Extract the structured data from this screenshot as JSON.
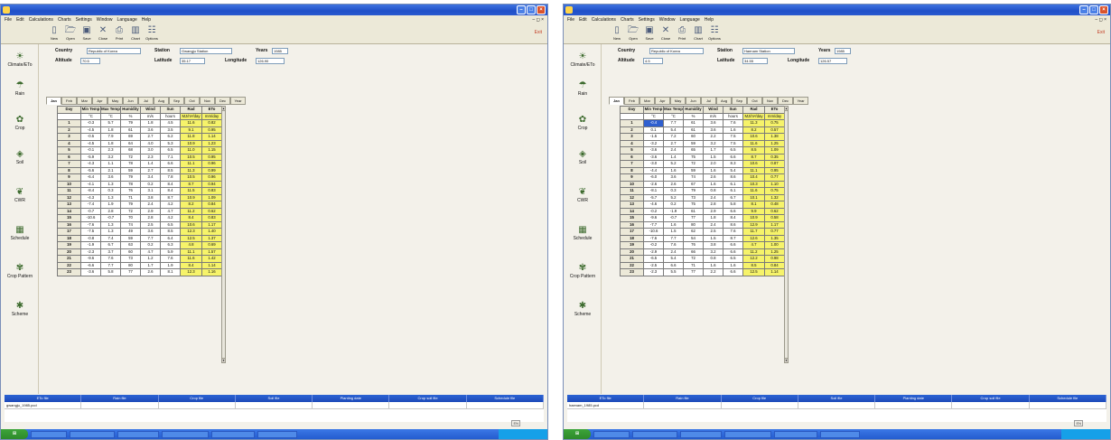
{
  "colors": {
    "title_bar": "#1f4fc7",
    "rad_column": "#f6f36a",
    "selection": "#2f5fd0",
    "taskbar": "#245ccf"
  },
  "menu": [
    "File",
    "Edit",
    "Calculations",
    "Charts",
    "Settings",
    "Window",
    "Language",
    "Help"
  ],
  "toolbar": [
    {
      "icon": "new-icon",
      "label": "New"
    },
    {
      "icon": "open-icon",
      "label": "Open"
    },
    {
      "icon": "save-icon",
      "label": "Save"
    },
    {
      "icon": "close-icon",
      "label": "Close"
    },
    {
      "icon": "print-icon",
      "label": "Print"
    },
    {
      "icon": "chart-icon",
      "label": "Chart"
    },
    {
      "icon": "options-icon",
      "label": "Options"
    }
  ],
  "exit_label": "Exit",
  "sidebar": [
    {
      "icon": "climate-icon",
      "label": "Climate/ETo"
    },
    {
      "icon": "rain-icon",
      "label": "Rain"
    },
    {
      "icon": "crop-icon",
      "label": "Crop"
    },
    {
      "icon": "soil-icon",
      "label": "Soil"
    },
    {
      "icon": "cwr-icon",
      "label": "CWR"
    },
    {
      "icon": "schedule-icon",
      "label": "Schedule"
    },
    {
      "icon": "crop-pattern-icon",
      "label": "Crop Pattern"
    },
    {
      "icon": "scheme-icon",
      "label": "Scheme"
    }
  ],
  "form_labels": {
    "country": "Country",
    "station": "Station",
    "years": "Years",
    "altitude": "Altitude",
    "latitude": "Latitude",
    "longitude": "Longitude"
  },
  "months": [
    "Jan",
    "Feb",
    "Mar",
    "Apr",
    "May",
    "Jun",
    "Jul",
    "Aug",
    "Sep",
    "Oct",
    "Nov",
    "Dec",
    "Year"
  ],
  "grid_headers": [
    "Day",
    "Min Temp",
    "Max Temp",
    "Humidity",
    "Wind",
    "Sun",
    "Rad",
    "ETo"
  ],
  "grid_units": [
    "",
    "°C",
    "°C",
    "%",
    "m/s",
    "hours",
    "MJ/m²/day",
    "mm/day"
  ],
  "file_headers": [
    "ETo file",
    "Rain file",
    "Crop file",
    "Soil file",
    "Planting date",
    "Crop soil file",
    "Schedule file"
  ],
  "shots": [
    {
      "country": "Republic of Korea",
      "station": "Gwangju Station",
      "years": "1985",
      "altitude": "70.5",
      "latitude": "35.17",
      "longitude": "126.90",
      "eto_file": "gwangju_1985.pcd",
      "rows": [
        [
          "1",
          "-0.3",
          "5.7",
          "79",
          "1.8",
          "4.5",
          "11.6",
          "0.82"
        ],
        [
          "2",
          "-4.5",
          "1.8",
          "61",
          "3.6",
          "3.5",
          "9.1",
          "0.95"
        ],
        [
          "3",
          "-0.5",
          "7.9",
          "69",
          "2.7",
          "6.2",
          "11.8",
          "1.14"
        ],
        [
          "4",
          "-4.5",
          "1.8",
          "64",
          "4.0",
          "5.3",
          "10.9",
          "1.23"
        ],
        [
          "5",
          "-0.1",
          "2.3",
          "68",
          "3.0",
          "6.5",
          "11.0",
          "1.15"
        ],
        [
          "6",
          "-5.9",
          "3.2",
          "72",
          "2.3",
          "7.1",
          "10.5",
          "0.95"
        ],
        [
          "7",
          "-4.3",
          "1.1",
          "78",
          "1.4",
          "6.6",
          "11.1",
          "0.96"
        ],
        [
          "8",
          "-5.6",
          "2.1",
          "59",
          "2.7",
          "8.5",
          "11.3",
          "0.99"
        ],
        [
          "9",
          "-6.4",
          "3.6",
          "79",
          "3.4",
          "7.8",
          "10.5",
          "0.96"
        ],
        [
          "10",
          "-4.1",
          "1.3",
          "78",
          "0.2",
          "8.4",
          "8.7",
          "0.94"
        ],
        [
          "11",
          "-8.4",
          "0.3",
          "76",
          "3.1",
          "8.4",
          "11.5",
          "0.83"
        ],
        [
          "12",
          "-4.3",
          "1.3",
          "71",
          "3.8",
          "8.7",
          "10.9",
          "1.09"
        ],
        [
          "13",
          "-7.4",
          "1.9",
          "79",
          "2.4",
          "4.2",
          "8.2",
          "0.84"
        ],
        [
          "14",
          "-0.7",
          "2.8",
          "72",
          "2.9",
          "4.7",
          "11.2",
          "0.62"
        ],
        [
          "15",
          "-10.6",
          "-0.7",
          "70",
          "2.8",
          "4.2",
          "8.4",
          "0.83"
        ],
        [
          "16",
          "-7.6",
          "1.3",
          "74",
          "2.5",
          "6.5",
          "10.6",
          "1.17"
        ],
        [
          "17",
          "-7.5",
          "1.3",
          "49",
          "3.6",
          "8.5",
          "12.3",
          "1.40"
        ],
        [
          "18",
          "-0.8",
          "7.4",
          "59",
          "7.7",
          "6.4",
          "12.5",
          "1.37"
        ],
        [
          "19",
          "-1.9",
          "6.7",
          "63",
          "0.2",
          "6.3",
          "4.8",
          "0.69"
        ],
        [
          "20",
          "-2.3",
          "3.7",
          "60",
          "4.7",
          "5.9",
          "11.1",
          "1.57"
        ],
        [
          "21",
          "-9.6",
          "7.6",
          "73",
          "1.2",
          "7.6",
          "11.6",
          "1.42"
        ],
        [
          "22",
          "-6.6",
          "7.7",
          "80",
          "1.7",
          "1.9",
          "8.4",
          "1.14"
        ],
        [
          "23",
          "-3.6",
          "5.8",
          "77",
          "2.6",
          "8.1",
          "12.3",
          "1.16"
        ]
      ],
      "selected_cell": null,
      "highlight_cell": [
        9,
        5
      ]
    },
    {
      "country": "Republic of Korea",
      "station": "Haenam Station",
      "years": "1985",
      "altitude": "4.5",
      "latitude": "34.55",
      "longitude": "126.57",
      "eto_file": "haenam_1985.pcd",
      "rows": [
        [
          "1",
          "-0.4",
          "7.7",
          "61",
          "3.6",
          "7.6",
          "11.3",
          "0.75"
        ],
        [
          "2",
          "0.1",
          "5.4",
          "61",
          "3.6",
          "1.6",
          "8.2",
          "0.57"
        ],
        [
          "3",
          "-1.5",
          "7.2",
          "60",
          "2.2",
          "7.5",
          "10.6",
          "1.38"
        ],
        [
          "4",
          "-3.2",
          "2.7",
          "59",
          "3.2",
          "7.5",
          "11.6",
          "1.25"
        ],
        [
          "5",
          "-3.6",
          "2.4",
          "65",
          "1.7",
          "6.5",
          "8.5",
          "1.09"
        ],
        [
          "6",
          "-3.6",
          "1.4",
          "75",
          "1.5",
          "6.6",
          "8.7",
          "0.35"
        ],
        [
          "7",
          "-3.0",
          "5.2",
          "72",
          "2.0",
          "8.3",
          "10.6",
          "0.87"
        ],
        [
          "8",
          "-4.4",
          "1.6",
          "59",
          "1.6",
          "5.4",
          "11.1",
          "0.95"
        ],
        [
          "9",
          "-6.0",
          "3.6",
          "74",
          "2.6",
          "8.6",
          "10.4",
          "0.77"
        ],
        [
          "10",
          "-2.6",
          "2.6",
          "67",
          "1.6",
          "6.1",
          "10.3",
          "1.10"
        ],
        [
          "11",
          "-8.1",
          "0.3",
          "79",
          "0.8",
          "6.1",
          "11.6",
          "0.75"
        ],
        [
          "12",
          "-5.7",
          "5.2",
          "73",
          "2.4",
          "6.7",
          "10.1",
          "1.32"
        ],
        [
          "13",
          "-4.6",
          "0.2",
          "75",
          "2.8",
          "5.8",
          "8.1",
          "0.48"
        ],
        [
          "14",
          "-0.2",
          "-1.9",
          "61",
          "2.9",
          "6.6",
          "9.9",
          "0.62"
        ],
        [
          "15",
          "-9.6",
          "-0.7",
          "77",
          "1.8",
          "8.4",
          "10.9",
          "0.58"
        ],
        [
          "16",
          "-7.7",
          "1.6",
          "80",
          "2.4",
          "8.6",
          "12.9",
          "1.17"
        ],
        [
          "17",
          "-10.6",
          "1.5",
          "62",
          "2.5",
          "7.6",
          "11.7",
          "0.77"
        ],
        [
          "18",
          "-7.6",
          "7.7",
          "54",
          "1.5",
          "8.7",
          "12.6",
          "1.35"
        ],
        [
          "19",
          "-0.2",
          "7.6",
          "76",
          "3.8",
          "6.6",
          "4.7",
          "1.00"
        ],
        [
          "20",
          "-2.9",
          "2.4",
          "66",
          "3.2",
          "6.6",
          "11.2",
          "1.25"
        ],
        [
          "21",
          "-6.5",
          "5.4",
          "72",
          "0.8",
          "6.5",
          "12.2",
          "0.98"
        ],
        [
          "22",
          "-2.5",
          "6.6",
          "71",
          "1.6",
          "1.6",
          "8.5",
          "0.84"
        ],
        [
          "23",
          "-2.3",
          "5.5",
          "77",
          "2.2",
          "6.6",
          "12.5",
          "1.14"
        ]
      ],
      "selected_cell": [
        0,
        1
      ],
      "highlight_cell": null
    }
  ]
}
